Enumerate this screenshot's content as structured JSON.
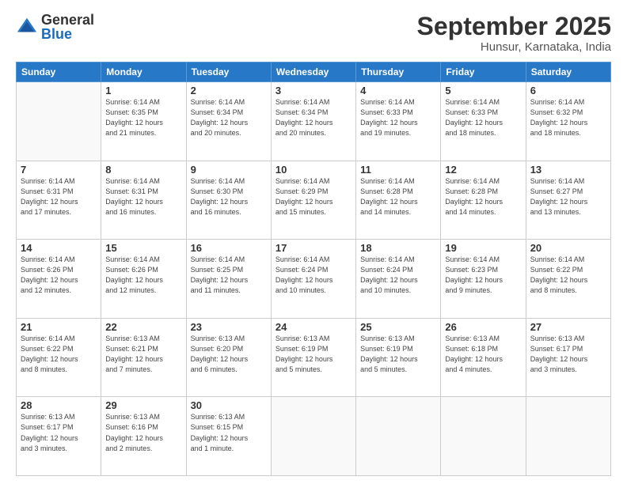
{
  "header": {
    "logo_general": "General",
    "logo_blue": "Blue",
    "month": "September 2025",
    "location": "Hunsur, Karnataka, India"
  },
  "weekdays": [
    "Sunday",
    "Monday",
    "Tuesday",
    "Wednesday",
    "Thursday",
    "Friday",
    "Saturday"
  ],
  "weeks": [
    [
      {
        "day": "",
        "info": ""
      },
      {
        "day": "1",
        "info": "Sunrise: 6:14 AM\nSunset: 6:35 PM\nDaylight: 12 hours\nand 21 minutes."
      },
      {
        "day": "2",
        "info": "Sunrise: 6:14 AM\nSunset: 6:34 PM\nDaylight: 12 hours\nand 20 minutes."
      },
      {
        "day": "3",
        "info": "Sunrise: 6:14 AM\nSunset: 6:34 PM\nDaylight: 12 hours\nand 20 minutes."
      },
      {
        "day": "4",
        "info": "Sunrise: 6:14 AM\nSunset: 6:33 PM\nDaylight: 12 hours\nand 19 minutes."
      },
      {
        "day": "5",
        "info": "Sunrise: 6:14 AM\nSunset: 6:33 PM\nDaylight: 12 hours\nand 18 minutes."
      },
      {
        "day": "6",
        "info": "Sunrise: 6:14 AM\nSunset: 6:32 PM\nDaylight: 12 hours\nand 18 minutes."
      }
    ],
    [
      {
        "day": "7",
        "info": "Sunrise: 6:14 AM\nSunset: 6:31 PM\nDaylight: 12 hours\nand 17 minutes."
      },
      {
        "day": "8",
        "info": "Sunrise: 6:14 AM\nSunset: 6:31 PM\nDaylight: 12 hours\nand 16 minutes."
      },
      {
        "day": "9",
        "info": "Sunrise: 6:14 AM\nSunset: 6:30 PM\nDaylight: 12 hours\nand 16 minutes."
      },
      {
        "day": "10",
        "info": "Sunrise: 6:14 AM\nSunset: 6:29 PM\nDaylight: 12 hours\nand 15 minutes."
      },
      {
        "day": "11",
        "info": "Sunrise: 6:14 AM\nSunset: 6:28 PM\nDaylight: 12 hours\nand 14 minutes."
      },
      {
        "day": "12",
        "info": "Sunrise: 6:14 AM\nSunset: 6:28 PM\nDaylight: 12 hours\nand 14 minutes."
      },
      {
        "day": "13",
        "info": "Sunrise: 6:14 AM\nSunset: 6:27 PM\nDaylight: 12 hours\nand 13 minutes."
      }
    ],
    [
      {
        "day": "14",
        "info": "Sunrise: 6:14 AM\nSunset: 6:26 PM\nDaylight: 12 hours\nand 12 minutes."
      },
      {
        "day": "15",
        "info": "Sunrise: 6:14 AM\nSunset: 6:26 PM\nDaylight: 12 hours\nand 12 minutes."
      },
      {
        "day": "16",
        "info": "Sunrise: 6:14 AM\nSunset: 6:25 PM\nDaylight: 12 hours\nand 11 minutes."
      },
      {
        "day": "17",
        "info": "Sunrise: 6:14 AM\nSunset: 6:24 PM\nDaylight: 12 hours\nand 10 minutes."
      },
      {
        "day": "18",
        "info": "Sunrise: 6:14 AM\nSunset: 6:24 PM\nDaylight: 12 hours\nand 10 minutes."
      },
      {
        "day": "19",
        "info": "Sunrise: 6:14 AM\nSunset: 6:23 PM\nDaylight: 12 hours\nand 9 minutes."
      },
      {
        "day": "20",
        "info": "Sunrise: 6:14 AM\nSunset: 6:22 PM\nDaylight: 12 hours\nand 8 minutes."
      }
    ],
    [
      {
        "day": "21",
        "info": "Sunrise: 6:14 AM\nSunset: 6:22 PM\nDaylight: 12 hours\nand 8 minutes."
      },
      {
        "day": "22",
        "info": "Sunrise: 6:13 AM\nSunset: 6:21 PM\nDaylight: 12 hours\nand 7 minutes."
      },
      {
        "day": "23",
        "info": "Sunrise: 6:13 AM\nSunset: 6:20 PM\nDaylight: 12 hours\nand 6 minutes."
      },
      {
        "day": "24",
        "info": "Sunrise: 6:13 AM\nSunset: 6:19 PM\nDaylight: 12 hours\nand 5 minutes."
      },
      {
        "day": "25",
        "info": "Sunrise: 6:13 AM\nSunset: 6:19 PM\nDaylight: 12 hours\nand 5 minutes."
      },
      {
        "day": "26",
        "info": "Sunrise: 6:13 AM\nSunset: 6:18 PM\nDaylight: 12 hours\nand 4 minutes."
      },
      {
        "day": "27",
        "info": "Sunrise: 6:13 AM\nSunset: 6:17 PM\nDaylight: 12 hours\nand 3 minutes."
      }
    ],
    [
      {
        "day": "28",
        "info": "Sunrise: 6:13 AM\nSunset: 6:17 PM\nDaylight: 12 hours\nand 3 minutes."
      },
      {
        "day": "29",
        "info": "Sunrise: 6:13 AM\nSunset: 6:16 PM\nDaylight: 12 hours\nand 2 minutes."
      },
      {
        "day": "30",
        "info": "Sunrise: 6:13 AM\nSunset: 6:15 PM\nDaylight: 12 hours\nand 1 minute."
      },
      {
        "day": "",
        "info": ""
      },
      {
        "day": "",
        "info": ""
      },
      {
        "day": "",
        "info": ""
      },
      {
        "day": "",
        "info": ""
      }
    ]
  ]
}
